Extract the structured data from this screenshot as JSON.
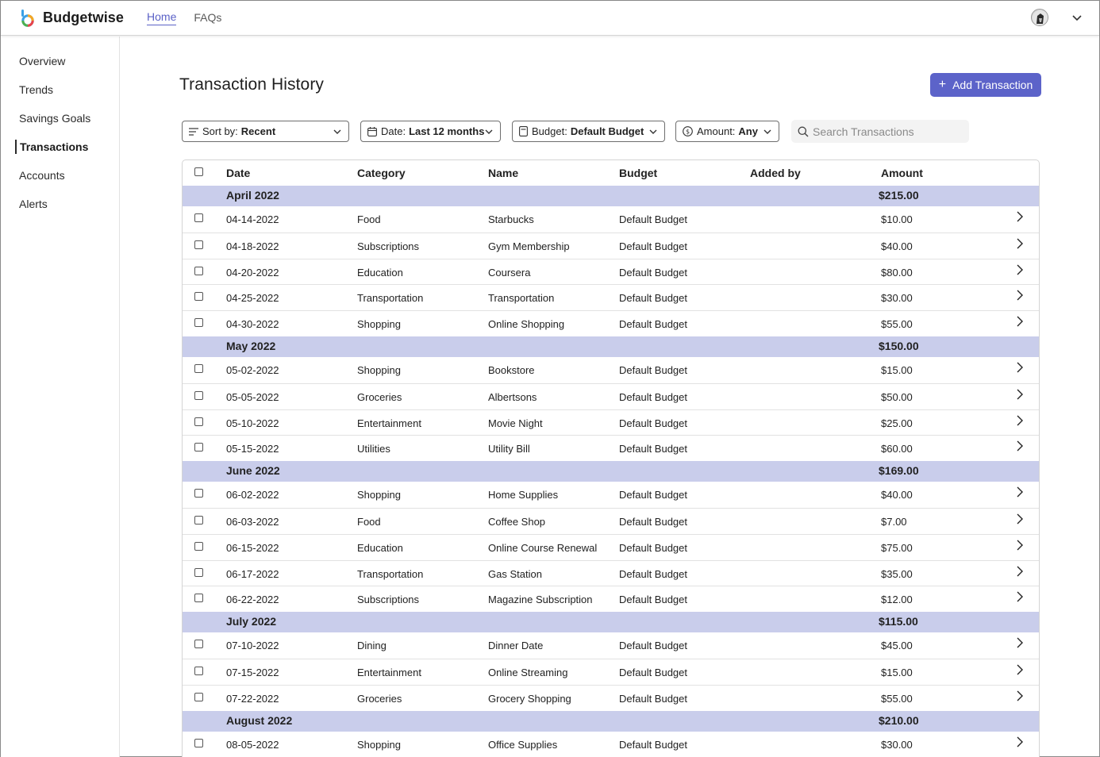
{
  "app": {
    "name": "Budgetwise",
    "nav": [
      {
        "label": "Home",
        "active": true
      },
      {
        "label": "FAQs",
        "active": false
      }
    ]
  },
  "sidebar": {
    "items": [
      {
        "label": "Overview",
        "active": false
      },
      {
        "label": "Trends",
        "active": false
      },
      {
        "label": "Savings Goals",
        "active": false
      },
      {
        "label": "Transactions",
        "active": true
      },
      {
        "label": "Accounts",
        "active": false
      },
      {
        "label": "Alerts",
        "active": false
      }
    ]
  },
  "main": {
    "title": "Transaction History",
    "add_button": "Add Transaction",
    "filters": {
      "sort": {
        "label": "Sort by:",
        "value": "Recent",
        "icon": "sort-lines-icon"
      },
      "date": {
        "label": "Date:",
        "value": "Last 12 months",
        "icon": "calendar-icon"
      },
      "budget": {
        "label": "Budget:",
        "value": "Default Budget",
        "icon": "wallet-icon"
      },
      "amount": {
        "label": "Amount:",
        "value": "Any",
        "icon": "dollar-circle-icon"
      }
    },
    "search": {
      "placeholder": "Search Transactions",
      "value": ""
    }
  },
  "table": {
    "columns": [
      "Date",
      "Category",
      "Name",
      "Budget",
      "Added by",
      "Amount"
    ],
    "groups": [
      {
        "month": "April 2022",
        "total": "$215.00",
        "rows": [
          {
            "date": "04-14-2022",
            "category": "Food",
            "name": "Starbucks",
            "budget": "Default Budget",
            "added_by": "",
            "amount": "$10.00"
          },
          {
            "date": "04-18-2022",
            "category": "Subscriptions",
            "name": "Gym Membership",
            "budget": "Default Budget",
            "added_by": "",
            "amount": "$40.00"
          },
          {
            "date": "04-20-2022",
            "category": "Education",
            "name": "Coursera",
            "budget": "Default Budget",
            "added_by": "",
            "amount": "$80.00"
          },
          {
            "date": "04-25-2022",
            "category": "Transportation",
            "name": "Transportation",
            "budget": "Default Budget",
            "added_by": "",
            "amount": "$30.00"
          },
          {
            "date": "04-30-2022",
            "category": "Shopping",
            "name": "Online Shopping",
            "budget": "Default Budget",
            "added_by": "",
            "amount": "$55.00"
          }
        ]
      },
      {
        "month": "May 2022",
        "total": "$150.00",
        "rows": [
          {
            "date": "05-02-2022",
            "category": "Shopping",
            "name": "Bookstore",
            "budget": "Default Budget",
            "added_by": "",
            "amount": "$15.00"
          },
          {
            "date": "05-05-2022",
            "category": "Groceries",
            "name": "Albertsons",
            "budget": "Default Budget",
            "added_by": "",
            "amount": "$50.00"
          },
          {
            "date": "05-10-2022",
            "category": "Entertainment",
            "name": "Movie Night",
            "budget": "Default Budget",
            "added_by": "",
            "amount": "$25.00"
          },
          {
            "date": "05-15-2022",
            "category": "Utilities",
            "name": "Utility Bill",
            "budget": "Default Budget",
            "added_by": "",
            "amount": "$60.00"
          }
        ]
      },
      {
        "month": "June 2022",
        "total": "$169.00",
        "rows": [
          {
            "date": "06-02-2022",
            "category": "Shopping",
            "name": "Home Supplies",
            "budget": "Default Budget",
            "added_by": "",
            "amount": "$40.00"
          },
          {
            "date": "06-03-2022",
            "category": "Food",
            "name": "Coffee Shop",
            "budget": "Default Budget",
            "added_by": "",
            "amount": "$7.00"
          },
          {
            "date": "06-15-2022",
            "category": "Education",
            "name": "Online Course Renewal",
            "budget": "Default Budget",
            "added_by": "",
            "amount": "$75.00"
          },
          {
            "date": "06-17-2022",
            "category": "Transportation",
            "name": "Gas Station",
            "budget": "Default Budget",
            "added_by": "",
            "amount": "$35.00"
          },
          {
            "date": "06-22-2022",
            "category": "Subscriptions",
            "name": "Magazine Subscription",
            "budget": "Default Budget",
            "added_by": "",
            "amount": "$12.00"
          }
        ]
      },
      {
        "month": "July 2022",
        "total": "$115.00",
        "rows": [
          {
            "date": "07-10-2022",
            "category": "Dining",
            "name": "Dinner Date",
            "budget": "Default Budget",
            "added_by": "",
            "amount": "$45.00"
          },
          {
            "date": "07-15-2022",
            "category": "Entertainment",
            "name": "Online Streaming",
            "budget": "Default Budget",
            "added_by": "",
            "amount": "$15.00"
          },
          {
            "date": "07-22-2022",
            "category": "Groceries",
            "name": "Grocery Shopping",
            "budget": "Default Budget",
            "added_by": "",
            "amount": "$55.00"
          }
        ]
      },
      {
        "month": "August 2022",
        "total": "$210.00",
        "rows": [
          {
            "date": "08-05-2022",
            "category": "Shopping",
            "name": "Office Supplies",
            "budget": "Default Budget",
            "added_by": "",
            "amount": "$30.00"
          }
        ]
      }
    ]
  },
  "colors": {
    "accent": "#5c63c9",
    "month_row_bg": "#c9cdeb",
    "nav_active": "#5b62c7"
  }
}
